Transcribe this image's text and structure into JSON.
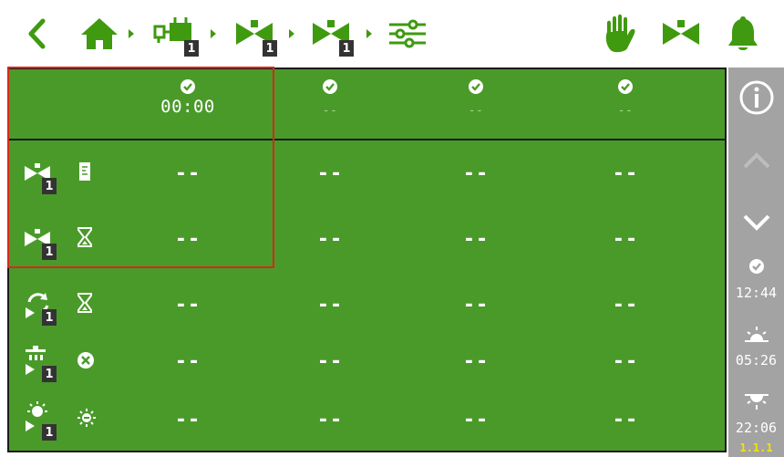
{
  "topbar": {
    "badges": [
      "1",
      "1",
      "1"
    ],
    "icons": [
      "back-chevron-icon",
      "home-icon",
      "controller-module-icon",
      "valve-icon",
      "valve-icon",
      "settings-sliders-icon",
      "manual-hand-icon",
      "valve-icon",
      "bell-icon"
    ]
  },
  "header": {
    "columns": [
      {
        "icon": "clock-check-icon",
        "time": "00:00"
      },
      {
        "icon": "clock-check-icon",
        "time": "--"
      },
      {
        "icon": "clock-check-icon",
        "time": "--"
      },
      {
        "icon": "clock-check-icon",
        "time": "--"
      }
    ]
  },
  "rows": [
    {
      "badge": "1",
      "icons": [
        "valve-icon",
        "level-meter-icon"
      ],
      "cells": [
        "--",
        "--",
        "--",
        "--"
      ]
    },
    {
      "badge": "1",
      "icons": [
        "valve-icon",
        "hourglass-icon"
      ],
      "cells": [
        "--",
        "--",
        "--",
        "--"
      ]
    },
    {
      "badge": "1",
      "icons": [
        "cycle-play-icon",
        "hourglass-icon"
      ],
      "cells": [
        "--",
        "--",
        "--",
        "--"
      ]
    },
    {
      "badge": "1",
      "icons": [
        "filter-play-icon",
        "cancel-circle-icon"
      ],
      "cells": [
        "--",
        "--",
        "--",
        "--"
      ]
    },
    {
      "badge": "1",
      "icons": [
        "sun-play-icon",
        "sun-minus-icon"
      ],
      "cells": [
        "--",
        "--",
        "--",
        "--"
      ]
    }
  ],
  "sidebar": {
    "clock_time": "12:44",
    "sunrise_time": "05:26",
    "sunset_time": "22:06",
    "version": "1.1.1"
  },
  "colors": {
    "accent_green": "#3f9a0f",
    "panel_green": "#4a9a2a",
    "selection_red": "#d42a1a",
    "sidebar_gray": "#a3a3a3",
    "version_yellow": "#f5e400"
  }
}
